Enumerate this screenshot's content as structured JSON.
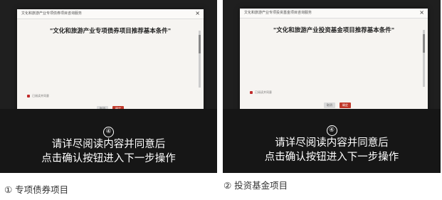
{
  "panels": [
    {
      "modal_header": "文化和旅游产业专项债券项目咨询服务",
      "modal_title": "\"文化和旅游产业专项债券项目推荐基本条件\"",
      "close": "×",
      "cancel": "取消",
      "ok": "确定",
      "agree_text": "已阅读并同意",
      "step_number": "④",
      "instruction_line1": "请详尽阅读内容并同意后",
      "instruction_line2": "点击确认按钮进入下一步操作",
      "caption": "① 专项债券项目"
    },
    {
      "modal_header": "文化和旅游产业专项投资基金项目咨询服务",
      "modal_title": "\"文化和旅游产业投资基金项目推荐基本条件\"",
      "close": "×",
      "cancel": "取消",
      "ok": "确定",
      "agree_text": "已阅读并同意",
      "step_number": "④",
      "instruction_line1": "请详尽阅读内容并同意后",
      "instruction_line2": "点击确认按钮进入下一步操作",
      "caption": "② 投资基金项目"
    }
  ],
  "colors": {
    "backdrop": "#1f1f1f",
    "accent": "#c0392b",
    "modal_bg": "#f6f4f1"
  }
}
